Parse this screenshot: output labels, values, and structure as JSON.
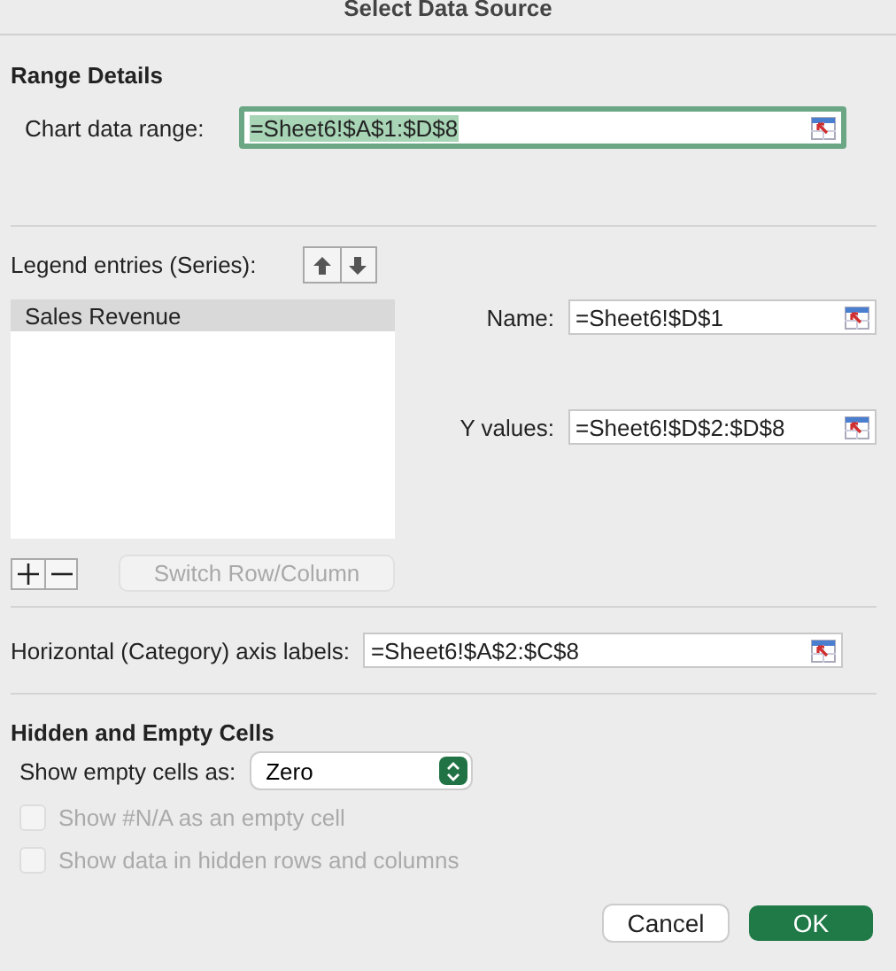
{
  "window": {
    "title": "Select Data Source"
  },
  "range_details": {
    "heading": "Range Details",
    "chart_data_range": {
      "label": "Chart data range:",
      "value": "=Sheet6!$A$1:$D$8",
      "focused": true
    }
  },
  "legend": {
    "label": "Legend entries (Series):",
    "series": [
      {
        "name": "Sales Revenue",
        "selected": true
      }
    ],
    "switch_button": {
      "label": "Switch Row/Column",
      "disabled": true
    }
  },
  "series_fields": [
    {
      "label": "Name:",
      "value": "=Sheet6!$D$1"
    },
    {
      "label": "Y values:",
      "value": "=Sheet6!$D$2:$D$8"
    }
  ],
  "axis_labels": {
    "label": "Horizontal (Category) axis labels:",
    "value": "=Sheet6!$A$2:$C$8"
  },
  "hidden_empty": {
    "heading": "Hidden and Empty Cells",
    "show_empty_as": {
      "label": "Show empty cells as:",
      "value": "Zero"
    },
    "options": [
      {
        "label": "Show #N/A as an empty cell",
        "checked": false,
        "disabled": true
      },
      {
        "label": "Show data in hidden rows and columns",
        "checked": false,
        "disabled": true
      }
    ]
  },
  "buttons": [
    {
      "label": "Cancel",
      "kind": "secondary"
    },
    {
      "label": "OK",
      "kind": "primary"
    }
  ]
}
